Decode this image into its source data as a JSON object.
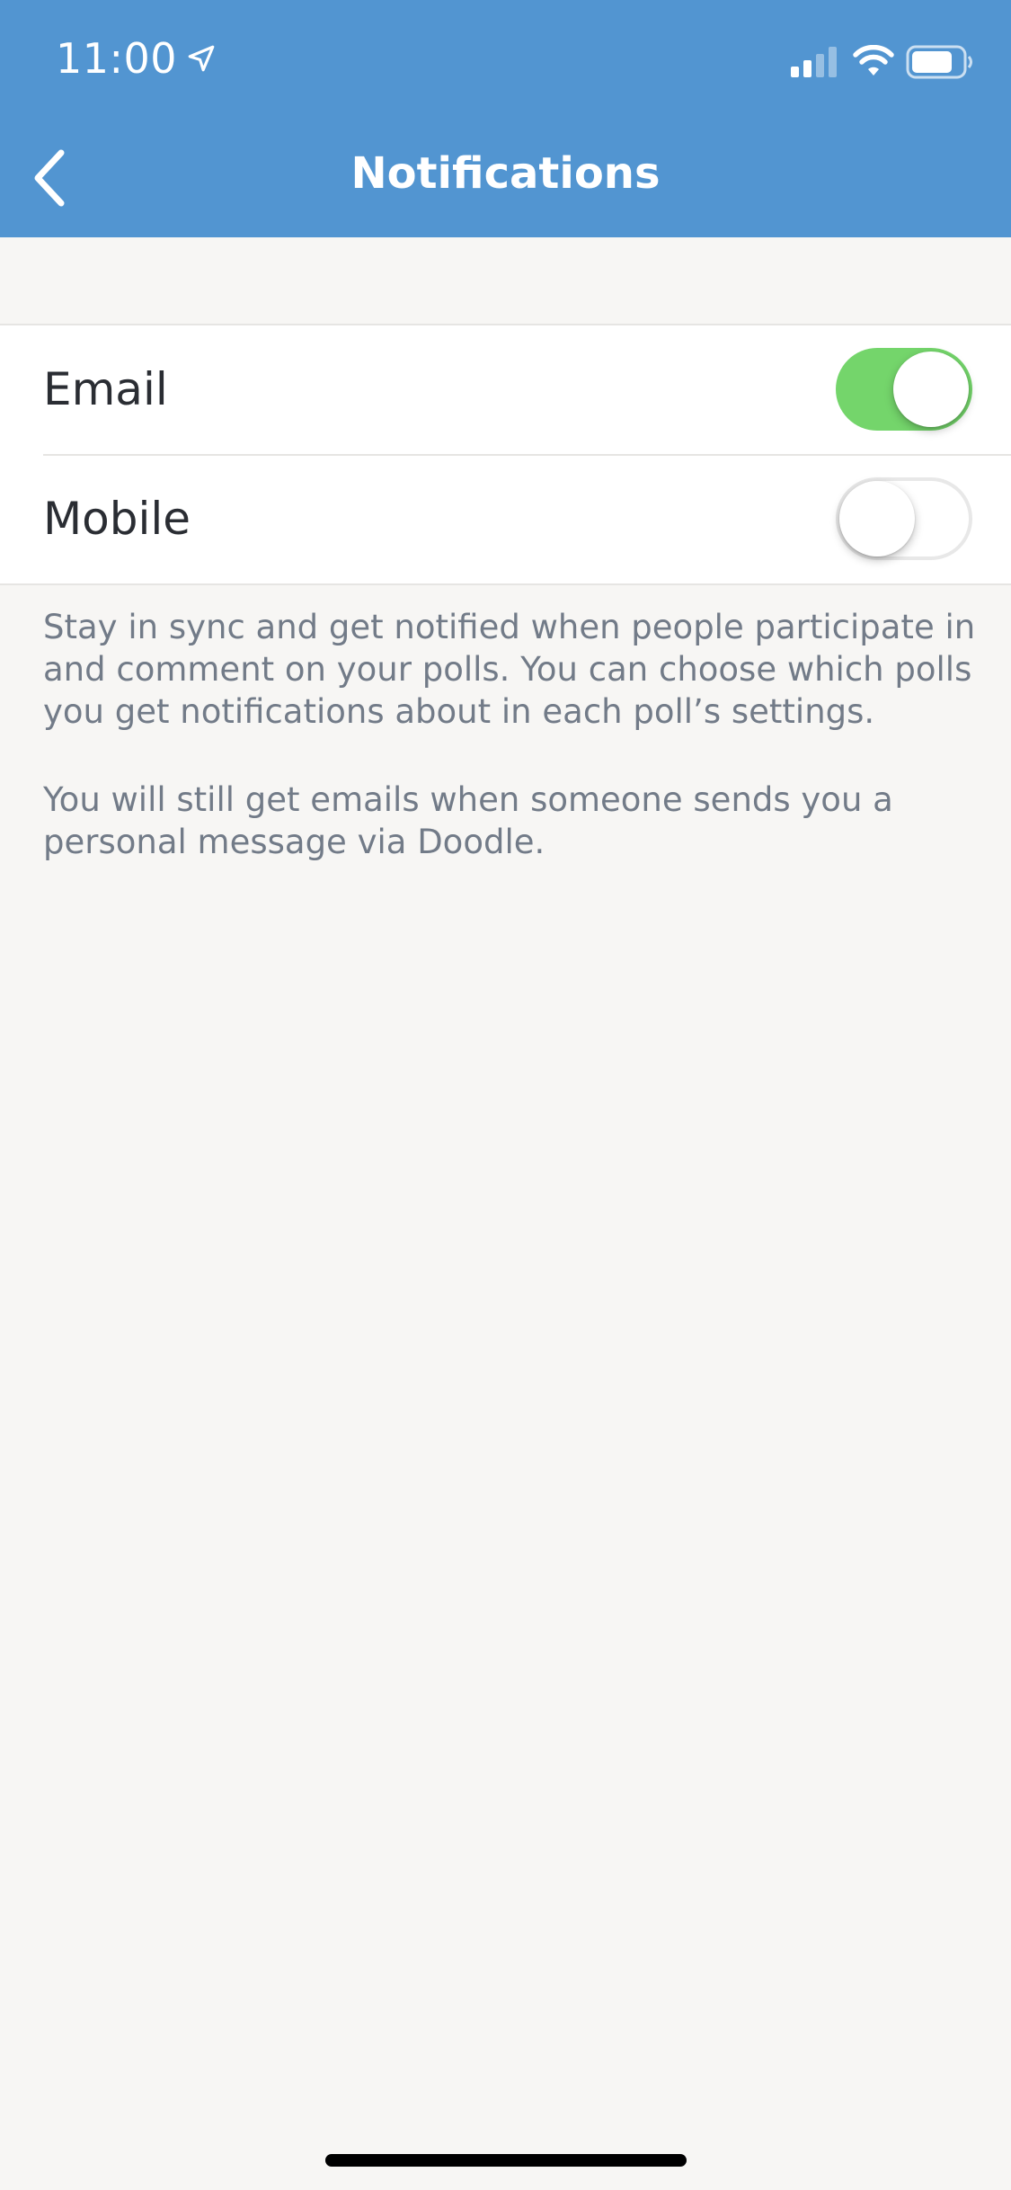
{
  "status_bar": {
    "time": "11:00"
  },
  "nav": {
    "title": "Notifications"
  },
  "settings": [
    {
      "label": "Email",
      "enabled": true
    },
    {
      "label": "Mobile",
      "enabled": false
    }
  ],
  "help": {
    "paragraph_1": "Stay in sync and get notified when people participate in and comment on your polls. You can choose which polls you get notifications about in each poll’s settings.",
    "paragraph_2": "You will still get emails when someone sends you a personal message via Doodle."
  },
  "colors": {
    "header": "#5295d1",
    "toggle_on": "#74d56b",
    "background": "#f7f6f4"
  },
  "icons": [
    "location-arrow-icon",
    "cellular-signal-icon",
    "wifi-icon",
    "battery-icon",
    "chevron-left-icon"
  ]
}
